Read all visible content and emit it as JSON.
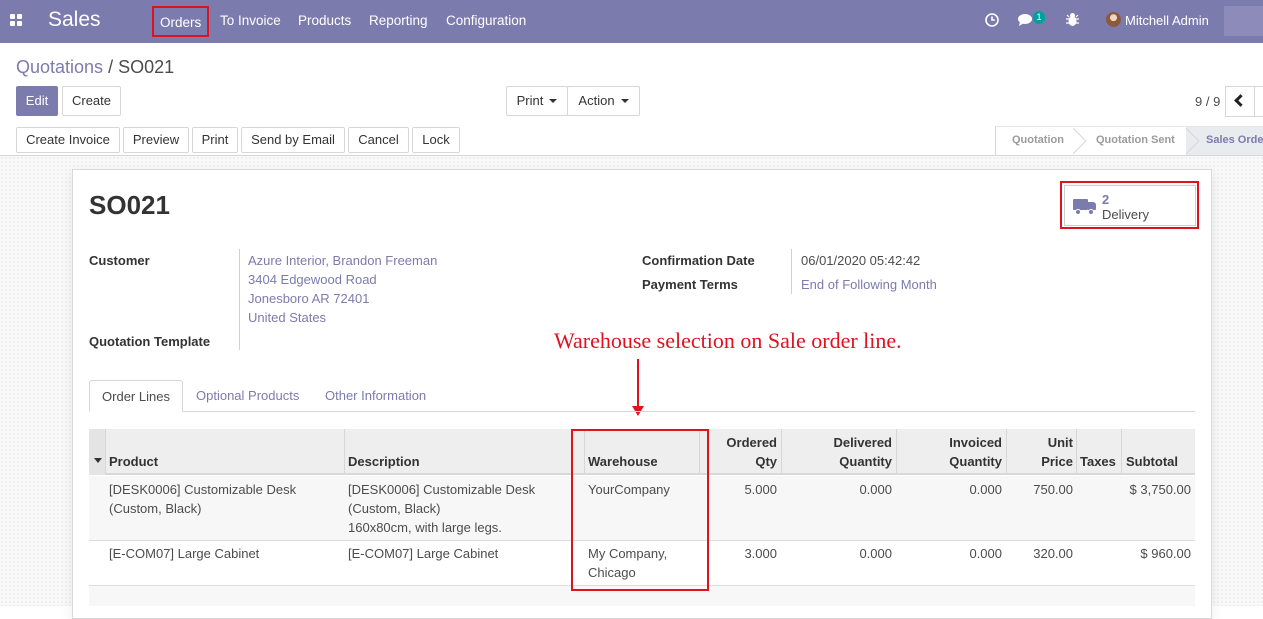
{
  "topbar": {
    "app_name": "Sales",
    "menu": [
      "Orders",
      "To Invoice",
      "Products",
      "Reporting",
      "Configuration"
    ],
    "highlighted_menu": "Orders",
    "messages_count": "1",
    "user_name": "Mitchell Admin",
    "icons": [
      "apps-grid-icon",
      "clock-icon",
      "chat-icon",
      "bug-icon"
    ]
  },
  "breadcrumb": {
    "parent": "Quotations",
    "separator": " / ",
    "current": "SO021"
  },
  "buttons": {
    "edit": "Edit",
    "create": "Create",
    "print": "Print",
    "action": "Action"
  },
  "pager": {
    "value": "9 / 9"
  },
  "statusbar": {
    "actions": [
      "Create Invoice",
      "Preview",
      "Print",
      "Send by Email",
      "Cancel",
      "Lock"
    ],
    "stages": [
      "Quotation",
      "Quotation Sent",
      "Sales Order"
    ],
    "active_stage": "Sales Order"
  },
  "record": {
    "name": "SO021",
    "smart_button": {
      "value": "2",
      "label": "Delivery",
      "icon": "truck-icon"
    },
    "customer_label": "Customer",
    "customer_lines": [
      "Azure Interior, Brandon Freeman",
      "3404 Edgewood Road",
      "Jonesboro AR 72401",
      "United States"
    ],
    "template_label": "Quotation Template",
    "confirmation_date_label": "Confirmation Date",
    "confirmation_date": "06/01/2020 05:42:42",
    "payment_terms_label": "Payment Terms",
    "payment_terms": "End of Following Month"
  },
  "annotation": "Warehouse selection on Sale order line.",
  "tabs": [
    "Order Lines",
    "Optional Products",
    "Other Information"
  ],
  "active_tab": "Order Lines",
  "order_lines": {
    "columns": {
      "product": "Product",
      "description": "Description",
      "warehouse": "Warehouse",
      "ordered_qty": [
        "Ordered",
        "Qty"
      ],
      "delivered_qty": [
        "Delivered",
        "Quantity"
      ],
      "invoiced_qty": [
        "Invoiced",
        "Quantity"
      ],
      "unit_price": [
        "Unit",
        "Price"
      ],
      "taxes": "Taxes",
      "subtotal": "Subtotal"
    },
    "rows": [
      {
        "product": [
          "[DESK0006] Customizable Desk",
          "(Custom, Black)"
        ],
        "description": [
          "[DESK0006] Customizable Desk",
          "(Custom, Black)",
          "160x80cm, with large legs."
        ],
        "warehouse": [
          "YourCompany"
        ],
        "ordered_qty": "5.000",
        "delivered_qty": "0.000",
        "invoiced_qty": "0.000",
        "unit_price": "750.00",
        "taxes": "",
        "subtotal": "$ 3,750.00"
      },
      {
        "product": [
          "[E-COM07] Large Cabinet"
        ],
        "description": [
          "[E-COM07] Large Cabinet"
        ],
        "warehouse": [
          "My Company,",
          "Chicago"
        ],
        "ordered_qty": "3.000",
        "delivered_qty": "0.000",
        "invoiced_qty": "0.000",
        "unit_price": "320.00",
        "taxes": "",
        "subtotal": "$ 960.00"
      }
    ]
  },
  "colors": {
    "brand": "#7c7bad",
    "highlight": "#e0121f",
    "badge": "#00a09d"
  }
}
